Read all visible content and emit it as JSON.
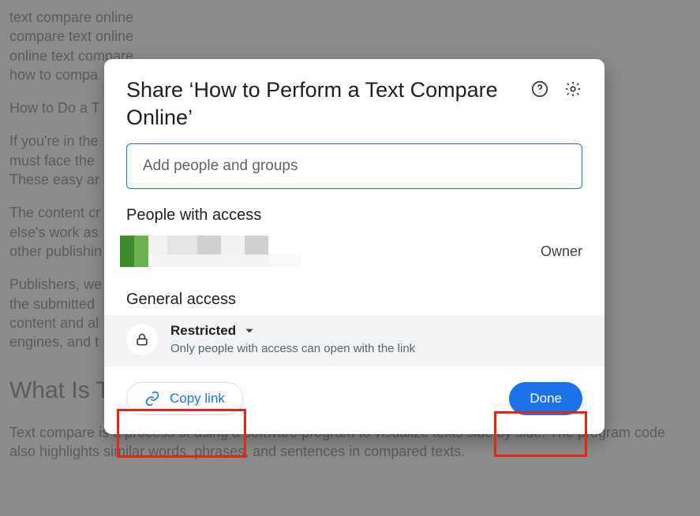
{
  "background": {
    "lines": [
      "text compare online",
      "compare text online",
      "online text compare",
      "how to compa"
    ],
    "p1": "How to Do a T",
    "p2": "If you're in the\nmust face the\nThese easy ar",
    "p3": "The content cr\nelse's work as\nother publishin",
    "p4": "Publishers, we\nthe submitted\ncontent and al\nengines, and t",
    "heading": "What Is T",
    "p5": "Text compare is a process of using a software program to visualize texts side by side. The program code also highlights similar words, phrases, and sentences in compared texts."
  },
  "dialog": {
    "title": "Share ‘How to Perform a Text Compare Online’",
    "input_placeholder": "Add people and groups",
    "people_header": "People with access",
    "owner_role": "Owner",
    "general_header": "General access",
    "restricted_label": "Restricted",
    "restricted_sub": "Only people with access can open with the link",
    "copy_link": "Copy link",
    "done": "Done"
  }
}
